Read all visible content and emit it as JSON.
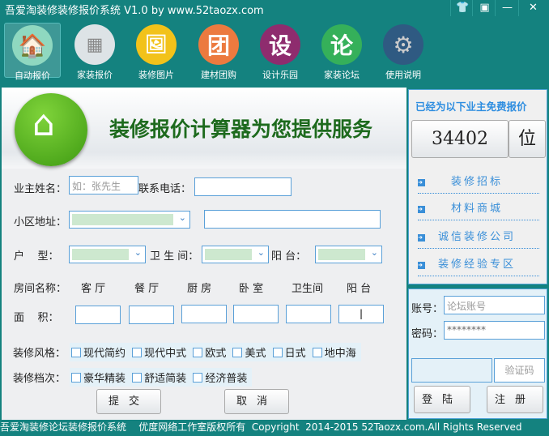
{
  "window": {
    "title": "吾爱淘装修装修报价系统 V1.0  by www.52taozx.com",
    "controls": [
      "skin",
      "menu",
      "minimize",
      "close"
    ]
  },
  "nav": [
    {
      "label": "自动报价",
      "icon": "house-icon",
      "color": "#8fd8c0"
    },
    {
      "label": "家装报价",
      "icon": "calculator-icon",
      "color": "#dde3e6"
    },
    {
      "label": "装修图片",
      "icon": "picture-icon",
      "color": "#f2c21a"
    },
    {
      "label": "建材团购",
      "icon": "团",
      "color": "#ec7a3f"
    },
    {
      "label": "设计乐园",
      "icon": "设",
      "color": "#8e2c6e"
    },
    {
      "label": "家装论坛",
      "icon": "论",
      "color": "#35b05a"
    },
    {
      "label": "使用说明",
      "icon": "gear-icon",
      "color": "#2f5a82"
    }
  ],
  "banner": {
    "title": "装修报价计算器为您提供服务"
  },
  "form": {
    "owner_label": "业主姓名：",
    "owner_placeholder": "如：张先生",
    "phone_label": "联系电话：",
    "phone_value": "",
    "address_label": "小区地址：",
    "address_value": "",
    "layout_label": "户    型：",
    "bath_label": "卫 生 间：",
    "balcony_label": "阳  台：",
    "rooms_label": "房间名称：",
    "rooms": [
      "客 厅",
      "餐 厅",
      "厨 房",
      "卧 室",
      "卫生间",
      "阳 台"
    ],
    "area_label": "面    积：",
    "style_label": "装修风格：",
    "styles": [
      "现代简约",
      "现代中式",
      "欧式",
      "美式",
      "日式",
      "地中海"
    ],
    "grade_label": "装修档次：",
    "grades": [
      "豪华精装",
      "舒适简装",
      "经济普装"
    ],
    "submit": "提交",
    "cancel": "取消"
  },
  "side": {
    "heading": "已经为以下业主免费报价",
    "count": "34402",
    "unit": "位",
    "links": [
      "装修招标",
      "材料商城",
      "诚信装修公司",
      "装修经验专区"
    ],
    "account_label": "账号：",
    "account_placeholder": "论坛账号",
    "password_label": "密码：",
    "password_value": "********",
    "captcha_label": "验证码",
    "login": "登陆",
    "register": "注册"
  },
  "footer": "吾爱淘装修论坛装修报价系统    优度网络工作室版权所有  Copyright  2014-2015 52Taozx.com.All Rights Reserved"
}
